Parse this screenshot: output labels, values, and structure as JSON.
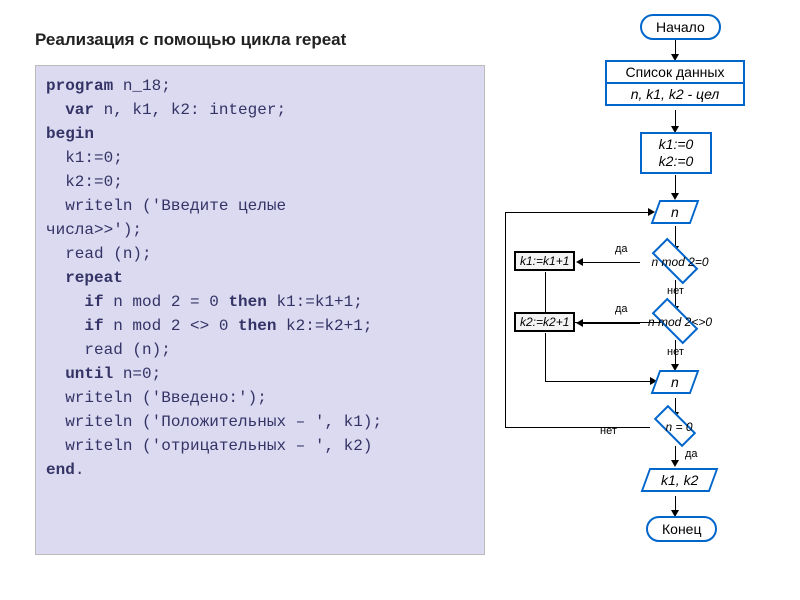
{
  "title": "Реализация с помощью цикла repeat",
  "code": {
    "line1": "program n_18;",
    "line2": "  var n, k1, k2: integer;",
    "line3": "begin",
    "line4": "  k1:=0;",
    "line5": "  k2:=0;",
    "line6": "  writeln ('Введите целые",
    "line7": "числа>>');",
    "line8": "  read (n);",
    "line9": "  repeat",
    "line10": "    if n mod 2 = 0 then k1:=k1+1;",
    "line11": "    if n mod 2 <> 0 then k2:=k2+1;",
    "line12": "    read (n);",
    "line13": "  until n=0;",
    "line14": "  writeln ('Введено:');",
    "line15": "  writeln ('Положительных – ', k1);",
    "line16": "  writeln ('отрицательных – ', k2)",
    "line17": "end."
  },
  "flowchart": {
    "start": "Начало",
    "datalist": "Список данных",
    "vars": "n, k1, k2 - цел",
    "init1": "k1:=0",
    "init2": "k2:=0",
    "input1": "n",
    "cond1": "n mod 2=0",
    "assign1": "k1:=k1+1",
    "cond2": "n mod 2<>0",
    "assign2": "k2:=k2+1",
    "input2": "n",
    "cond3": "n = 0",
    "output": "k1, k2",
    "end": "Конец",
    "yes": "да",
    "no": "нет"
  },
  "chart_data": {
    "type": "flowchart",
    "nodes": [
      {
        "id": "start",
        "shape": "terminal",
        "label": "Начало"
      },
      {
        "id": "datalist",
        "shape": "process",
        "label": "Список данных\nn, k1, k2 - цел"
      },
      {
        "id": "init",
        "shape": "process",
        "label": "k1:=0\nk2:=0"
      },
      {
        "id": "input_n1",
        "shape": "io",
        "label": "n"
      },
      {
        "id": "cond_even",
        "shape": "decision",
        "label": "n mod 2=0"
      },
      {
        "id": "inc_k1",
        "shape": "process",
        "label": "k1:=k1+1"
      },
      {
        "id": "cond_odd",
        "shape": "decision",
        "label": "n mod 2<>0"
      },
      {
        "id": "inc_k2",
        "shape": "process",
        "label": "k2:=k2+1"
      },
      {
        "id": "input_n2",
        "shape": "io",
        "label": "n"
      },
      {
        "id": "cond_zero",
        "shape": "decision",
        "label": "n = 0"
      },
      {
        "id": "output",
        "shape": "io",
        "label": "k1, k2"
      },
      {
        "id": "end",
        "shape": "terminal",
        "label": "Конец"
      }
    ],
    "edges": [
      {
        "from": "start",
        "to": "datalist"
      },
      {
        "from": "datalist",
        "to": "init"
      },
      {
        "from": "init",
        "to": "input_n1"
      },
      {
        "from": "input_n1",
        "to": "cond_even"
      },
      {
        "from": "cond_even",
        "to": "inc_k1",
        "label": "да"
      },
      {
        "from": "cond_even",
        "to": "cond_odd",
        "label": "нет"
      },
      {
        "from": "inc_k1",
        "to": "cond_odd"
      },
      {
        "from": "cond_odd",
        "to": "inc_k2",
        "label": "да"
      },
      {
        "from": "cond_odd",
        "to": "input_n2",
        "label": "нет"
      },
      {
        "from": "inc_k2",
        "to": "input_n2"
      },
      {
        "from": "input_n2",
        "to": "cond_zero"
      },
      {
        "from": "cond_zero",
        "to": "input_n1",
        "label": "нет"
      },
      {
        "from": "cond_zero",
        "to": "output",
        "label": "да"
      },
      {
        "from": "output",
        "to": "end"
      }
    ]
  }
}
